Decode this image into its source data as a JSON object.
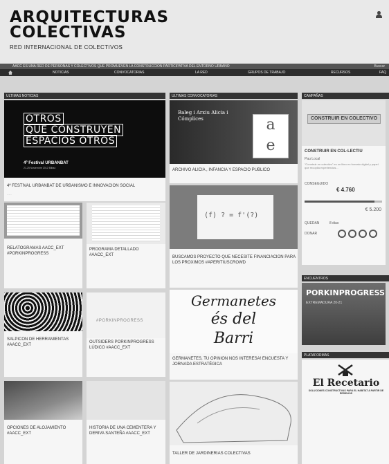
{
  "header": {
    "logo_line1": "ARQUITECTURAS",
    "logo_line2": "COLECTIVAS",
    "subtitle": "RED INTERNACIONAL DE COLECTIVOS",
    "user_icon": "user-icon"
  },
  "tagline": {
    "text": "AACC ES UNA RED DE PERSONAS Y COLECTIVOS QUE PROMUEVEN LA CONSTRUCCION PARTICIPATIVA DEL ENTORNO URBANO",
    "search": "Buscar"
  },
  "nav": {
    "home_icon": "home-icon",
    "items": [
      "NOTICIAS",
      "CONVOCATORIAS",
      "LA RED",
      "GRUPOS DE TRABAJO",
      "RECURSOS",
      "FAQ"
    ]
  },
  "columns": {
    "noticias": "ULTIMAS NOTICIAS",
    "convocatorias": "ULTIMAS CONVOCATORIAS",
    "campanas": "CAMPAÑAS",
    "encuentros": "ENCUENTROS",
    "plataformas": "PLATAFORMAS"
  },
  "noticias": {
    "featured": {
      "image_line1": "OTROS",
      "image_line2": "QUE CONSTRUYEN",
      "image_line3": "ESPACIOS OTROS",
      "image_festival": "4º Festival URBANBAT",
      "image_small": "21-25 Noviembre 2012 Bilbao",
      "title": "4º FESTIVAL URBANBAT DE URBANISMO E INNOVACION SOCIAL"
    },
    "cards": [
      {
        "title": "RELATOGRAMAS AACC_EXT #PORKINPROGRESS"
      },
      {
        "title": "PROGRAMA DETALLADO #AACC_EXT"
      },
      {
        "title": "SALPICON DE HERRAMIENTAS #AACC_EXT"
      },
      {
        "title": "OUTSIDERS PORKINPROGRESS LÚDICO #AACC_EXT",
        "image_text": "#PORKINPROGRESS"
      },
      {
        "title": "OPCIONES DE ALOJAMIENTO #AACC_EXT"
      },
      {
        "title": "HISTORIA DE UNA CEMENTERA Y DERIVA SANTEÑA #AACC_EXT"
      }
    ]
  },
  "convocatorias": {
    "cards": [
      {
        "title": "ARCHIVO ALICIA , INFANCIA Y ESPACIO PUBLICO",
        "image_text": "Baleg i Arxiu Alicia i Cómplices",
        "logo_top": "a",
        "logo_bottom": "e"
      },
      {
        "title": "BUSCAMOS PROYECTO QUE NECESITE FINANCIACION PARA LOS PROXIMOS #APERITIUSCROWD",
        "image_text": "(f) ? = f'(?)"
      },
      {
        "title": "GERMANETES, TU OPINION NOS INTERESA! ENCUESTA Y JORNADA ESTRATÉGICA",
        "image_line1": "Germanetes",
        "image_line2": "és del",
        "image_line3": "Barri"
      },
      {
        "title": "TALLER DE JARDINERIAS COLECTIVAS"
      }
    ]
  },
  "campana": {
    "banner": "CONSTRUIR EN COLECTIVO",
    "title": "CONSTRUIR EN COL·LECTIU",
    "place": "Pau Local",
    "desc": "\"Construir en colectivo\" es un libro en formato digital y papel que recopila experiencias...",
    "raised_label": "CONSEGUIDO",
    "raised": "€ 4.760",
    "goal": "€ 5.200",
    "progress": 0.9,
    "days_label": "QUEDAN",
    "days": "8 dias",
    "total_label": "DONAR",
    "donate_circles": 4
  },
  "encuentros": {
    "title": "PORKINPROGRESS",
    "date": "EXTREMADURA 20-21"
  },
  "plataformas": {
    "name": "El Recetario",
    "sub": "SOLUCIONES CONSTRUCTIVAS PARA EL HABITAT A PARTIR DE RESIDUOS"
  },
  "colors": {
    "nav_bg": "#2d2d2d",
    "tagline_bg": "#555555",
    "column_header_bg": "#333333",
    "card_bg": "#f6f6f6",
    "page_bg": "#d4d4d4"
  }
}
